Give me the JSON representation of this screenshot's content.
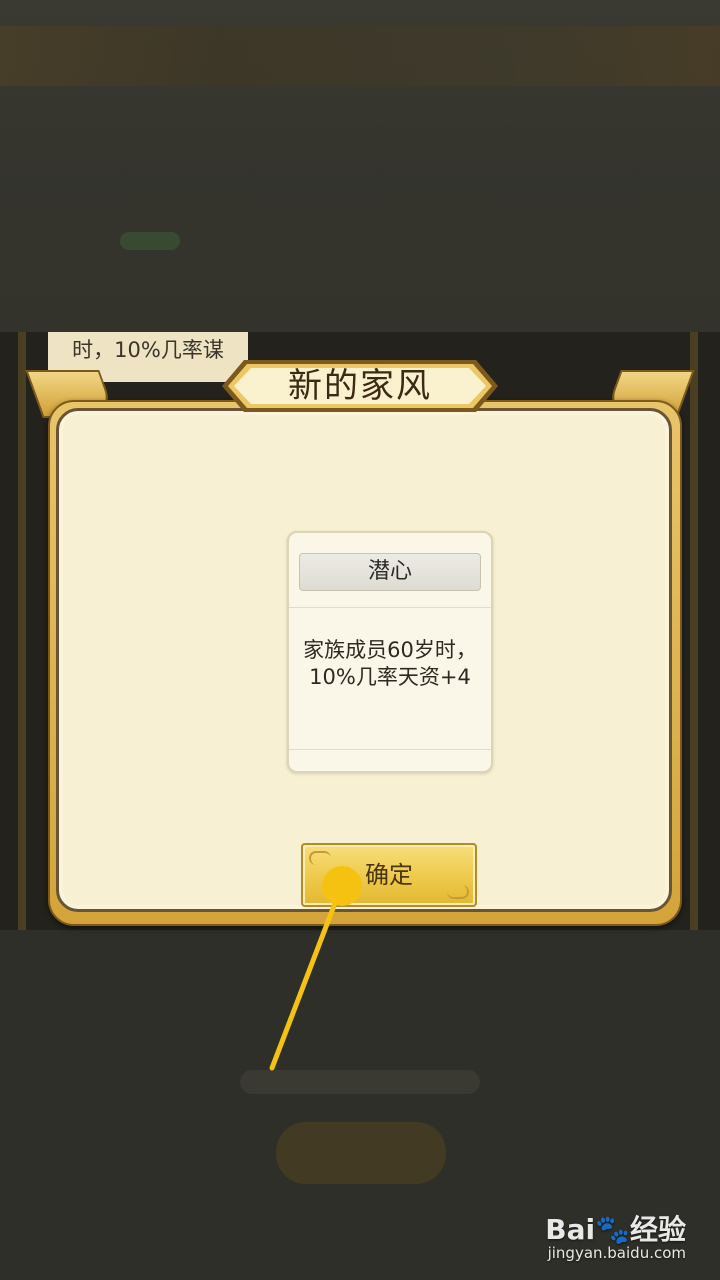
{
  "background": {
    "card_snippet": "时，10%几率谋"
  },
  "dialog": {
    "title": "新的家风",
    "motto": {
      "name": "潜心",
      "description": "家族成员60岁时，10%几率天资+4"
    },
    "confirm_label": "确定"
  },
  "annotation": {
    "color": "#f6c211"
  },
  "watermark": {
    "logo": "Bai🐾经验",
    "url": "jingyan.baidu.com"
  }
}
